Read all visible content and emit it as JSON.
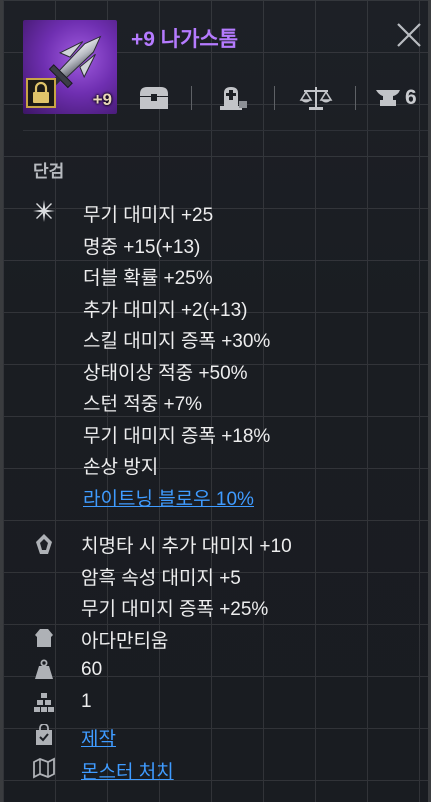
{
  "item": {
    "name": "+9 나가스톰",
    "enhance": "+9",
    "icon": "dagger-icon",
    "locked": true,
    "name_color": "#b57bff"
  },
  "toolbar": {
    "icons": [
      "chest-icon",
      "tombstone-icon",
      "scale-icon",
      "anvil-icon"
    ],
    "anvil_count": "6"
  },
  "item_type": "단검",
  "base_stats": [
    "무기 대미지 +25",
    "명중 +15(+13)",
    "더블 확률 +25%",
    "추가 대미지 +2(+13)",
    "스킬 대미지 증폭 +30%",
    "상태이상 적중 +50%",
    "스턴 적중 +7%",
    "무기 대미지 증폭 +18%",
    "손상 방지"
  ],
  "skill_link": "라이트닝 블로우 10%",
  "special_stats": [
    "치명타 시 추가 대미지 +10",
    "암흑 속성 대미지 +5",
    "무기 대미지 증폭 +25%"
  ],
  "material": "아다만티움",
  "weight": "60",
  "quantity": "1",
  "craft_label": "제작",
  "source_label": "몬스터 처치",
  "colors": {
    "link": "#3f9bff",
    "lock_border": "#c8a545"
  }
}
